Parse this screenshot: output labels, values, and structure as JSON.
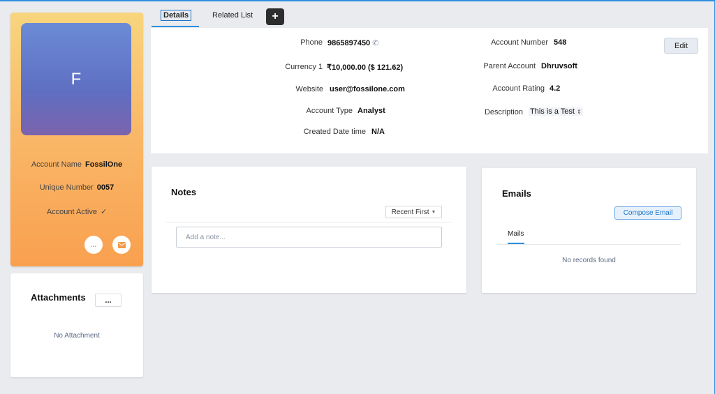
{
  "profile": {
    "initial": "F",
    "fields": [
      {
        "label": "Account Name",
        "value": "FossilOne"
      },
      {
        "label": "Unique Number",
        "value": "0057"
      },
      {
        "label": "Account Active",
        "value": "✓"
      }
    ],
    "more_label": "...",
    "mail_icon": "envelope-icon"
  },
  "attachments": {
    "title": "Attachments",
    "more_label": "...",
    "empty_text": "No Attachment"
  },
  "tabs": {
    "details": "Details",
    "related": "Related List",
    "add": "+"
  },
  "details": {
    "left": [
      {
        "label": "Phone",
        "value": "9865897450"
      },
      {
        "label": "Currency 1",
        "value": "₹10,000.00 ($ 121.62)"
      },
      {
        "label": "Website",
        "value": "user@fossilone.com"
      },
      {
        "label": "Account Type",
        "value": "Analyst"
      },
      {
        "label": "Created Date time",
        "value": "N/A"
      }
    ],
    "right": [
      {
        "label": "Account Number",
        "value": "548"
      },
      {
        "label": "Parent Account",
        "value": "Dhruvsoft"
      },
      {
        "label": "Account Rating",
        "value": "4.2"
      },
      {
        "label": "Description",
        "value": "This is  a Test"
      }
    ],
    "edit_label": "Edit"
  },
  "notes": {
    "title": "Notes",
    "sort_label": "Recent First",
    "placeholder": "Add a note..."
  },
  "emails": {
    "title": "Emails",
    "compose_label": "Compose Email",
    "tab_label": "Mails",
    "empty_text": "No records found"
  },
  "colors": {
    "accent": "#2f8fe0",
    "profile_gradient_top": "#f8d57e",
    "profile_gradient_bottom": "#f9a04f",
    "avatar_gradient_top": "#6b8bd6",
    "avatar_gradient_bottom": "#7b63ad"
  }
}
